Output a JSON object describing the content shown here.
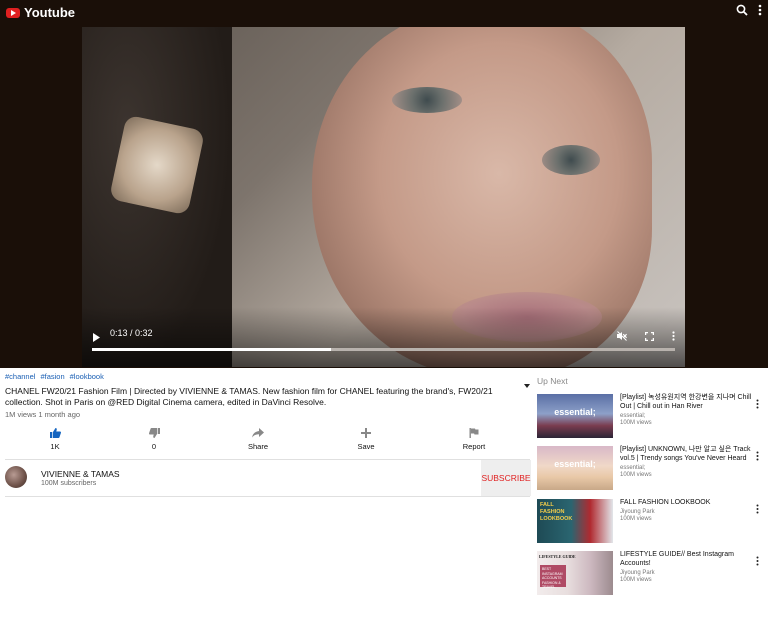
{
  "header": {
    "logo_text": "Youtube",
    "icons": [
      "search-icon",
      "more-vert-icon"
    ]
  },
  "player": {
    "time": "0:13 / 0:32",
    "progress": 0.41,
    "icons": [
      "play-icon",
      "mute-icon",
      "fullscreen-icon",
      "more-vert-icon"
    ]
  },
  "video": {
    "tags": [
      "#channel",
      "#fasion",
      "#lookbook"
    ],
    "description": "CHANEL FW20/21 Fashion Film | Directed by VIVIENNE & TAMAS. New fashion film for CHANEL featuring the brand's, FW20/21 collection. Shot in Paris on @RED Digital Cinema camera, edited in DaVinci Resolve.",
    "meta": "1M views 1 month ago"
  },
  "actions": {
    "like": {
      "count": "1K",
      "icon": "thumb-up-icon"
    },
    "dislike": {
      "count": "0",
      "icon": "thumb-down-icon"
    },
    "share": {
      "label": "Share",
      "icon": "share-icon"
    },
    "save": {
      "label": "Save",
      "icon": "plus-icon"
    },
    "report": {
      "label": "Report",
      "icon": "flag-icon"
    }
  },
  "channel": {
    "name": "VIVIENNE & TAMAS",
    "subscribers": "100M subscribers",
    "subscribe_label": "SUBSCRIBE"
  },
  "sidebar": {
    "title": "Up Next",
    "items": [
      {
        "thumb_text": "essential;",
        "title": "[Playlist] 녹성유원지역 한강변을 지나며 Chill Out | Chill out in Han River",
        "channel": "essential;",
        "views": "100M views"
      },
      {
        "thumb_text": "essential;",
        "title": "[Playlist] UNKNOWN, 나만 알고 싶은 Track vol.5 | Trendy songs You've Never Heard",
        "channel": "essential;",
        "views": "100M views"
      },
      {
        "thumb_text": "FALL FASHION LOOKBOOK",
        "title": "FALL FASHION LOOKBOOK",
        "channel": "Jiyoung Park",
        "views": "100M views"
      },
      {
        "thumb_text": "LIFESTYLE GUIDE",
        "thumb_box_text": "BEST INSTAGRAM ACCOUNTS FASHION & TRAVEL",
        "title": "LIFESTYLE GUIDE// Best Instagram Accounts!",
        "channel": "Jiyoung Park",
        "views": "100M views"
      }
    ]
  },
  "colors": {
    "accent": "#e02020",
    "link": "#1a5fb4",
    "like_active": "#1565c0",
    "topbar": "#1a0f08"
  }
}
